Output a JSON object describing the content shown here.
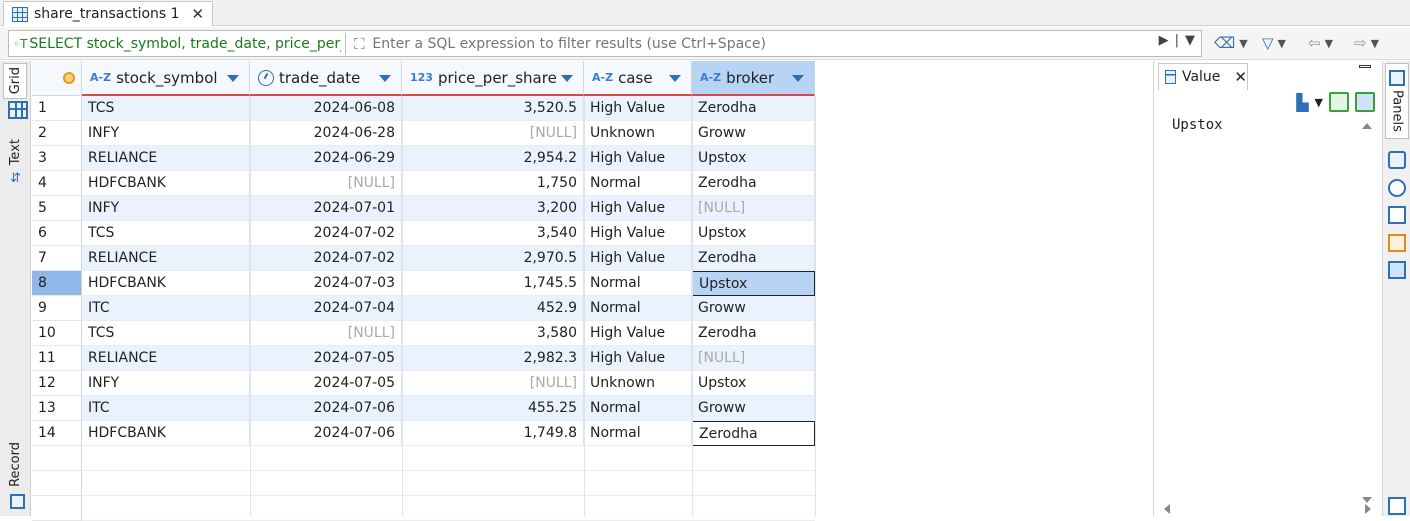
{
  "tab": {
    "title": "share_transactions 1"
  },
  "filter": {
    "sql_prefix": "◦T",
    "sql": "SELECT stock_symbol, trade_date, price_per_share",
    "placeholder": "Enter a SQL expression to filter results (use Ctrl+Space)"
  },
  "left_tabs": {
    "grid": "Grid",
    "text": "Text",
    "record": "Record"
  },
  "columns": [
    {
      "type": "A-Z",
      "name": "stock_symbol"
    },
    {
      "type": "clock",
      "name": "trade_date"
    },
    {
      "type": "123",
      "name": "price_per_share"
    },
    {
      "type": "A-Z",
      "name": "case"
    },
    {
      "type": "A-Z",
      "name": "broker"
    }
  ],
  "rows": [
    {
      "n": "1",
      "symbol": "TCS",
      "date": "2024-06-08",
      "price": "3,520.5",
      "case": "High Value",
      "broker": "Zerodha"
    },
    {
      "n": "2",
      "symbol": "INFY",
      "date": "2024-06-28",
      "price": "[NULL]",
      "case": "Unknown",
      "broker": "Groww"
    },
    {
      "n": "3",
      "symbol": "RELIANCE",
      "date": "2024-06-29",
      "price": "2,954.2",
      "case": "High Value",
      "broker": "Upstox"
    },
    {
      "n": "4",
      "symbol": "HDFCBANK",
      "date": "[NULL]",
      "price": "1,750",
      "case": "Normal",
      "broker": "Zerodha"
    },
    {
      "n": "5",
      "symbol": "INFY",
      "date": "2024-07-01",
      "price": "3,200",
      "case": "High Value",
      "broker": "[NULL]"
    },
    {
      "n": "6",
      "symbol": "TCS",
      "date": "2024-07-02",
      "price": "3,540",
      "case": "High Value",
      "broker": "Upstox"
    },
    {
      "n": "7",
      "symbol": "RELIANCE",
      "date": "2024-07-02",
      "price": "2,970.5",
      "case": "High Value",
      "broker": "Zerodha"
    },
    {
      "n": "8",
      "symbol": "HDFCBANK",
      "date": "2024-07-03",
      "price": "1,745.5",
      "case": "Normal",
      "broker": "Upstox"
    },
    {
      "n": "9",
      "symbol": "ITC",
      "date": "2024-07-04",
      "price": "452.9",
      "case": "Normal",
      "broker": "Groww"
    },
    {
      "n": "10",
      "symbol": "TCS",
      "date": "[NULL]",
      "price": "3,580",
      "case": "High Value",
      "broker": "Zerodha"
    },
    {
      "n": "11",
      "symbol": "RELIANCE",
      "date": "2024-07-05",
      "price": "2,982.3",
      "case": "High Value",
      "broker": "[NULL]"
    },
    {
      "n": "12",
      "symbol": "INFY",
      "date": "2024-07-05",
      "price": "[NULL]",
      "case": "Unknown",
      "broker": "Upstox"
    },
    {
      "n": "13",
      "symbol": "ITC",
      "date": "2024-07-06",
      "price": "455.25",
      "case": "Normal",
      "broker": "Groww"
    },
    {
      "n": "14",
      "symbol": "HDFCBANK",
      "date": "2024-07-06",
      "price": "1,749.8",
      "case": "Normal",
      "broker": "Zerodha"
    }
  ],
  "selected_row": "8",
  "value_panel": {
    "title": "Value",
    "content": "Upstox"
  },
  "right_bar": {
    "panels_label": "Panels"
  },
  "colors": {
    "accent": "#2f6fb5",
    "selection": "#b7d4f5",
    "row_alt": "#eaf3fd",
    "null_text": "#a9a9a9",
    "sql_text": "#1a7a1a"
  }
}
